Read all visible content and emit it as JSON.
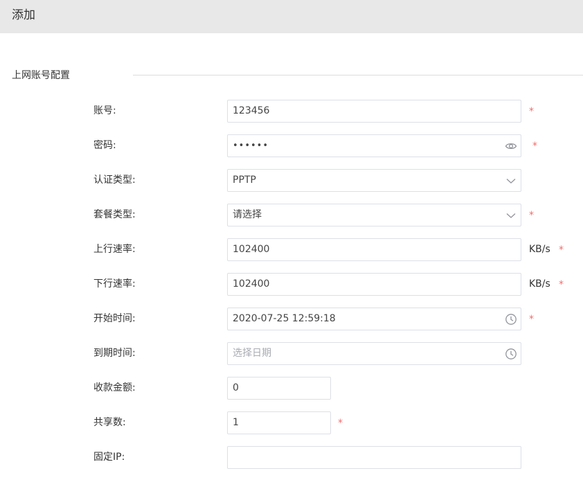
{
  "header": {
    "title": "添加"
  },
  "section": {
    "title": "上网账号配置"
  },
  "form": {
    "account": {
      "label": "账号:",
      "value": "123456",
      "required": "*"
    },
    "password": {
      "label": "密码:",
      "value": "••••••",
      "required": "*",
      "icon": "eye-icon"
    },
    "auth_type": {
      "label": "认证类型:",
      "value": "PPTP",
      "icon": "chevron-down-icon"
    },
    "package_type": {
      "label": "套餐类型:",
      "placeholder": "请选择",
      "required": "*",
      "icon": "chevron-down-icon"
    },
    "upload_rate": {
      "label": "上行速率:",
      "value": "102400",
      "unit": "KB/s",
      "required": "*"
    },
    "download_rate": {
      "label": "下行速率:",
      "value": "102400",
      "unit": "KB/s",
      "required": "*"
    },
    "start_time": {
      "label": "开始时间:",
      "value": "2020-07-25 12:59:18",
      "required": "*",
      "icon": "clock-icon"
    },
    "expire_time": {
      "label": "到期时间:",
      "placeholder": "选择日期",
      "icon": "clock-icon"
    },
    "amount": {
      "label": "收款金额:",
      "value": "0"
    },
    "share_count": {
      "label": "共享数:",
      "value": "1",
      "required": "*"
    },
    "fixed_ip": {
      "label": "固定IP:",
      "value": ""
    }
  },
  "colors": {
    "required": "#f56c6c",
    "header_bg": "#e8e8e8",
    "border": "#dcdfe6"
  }
}
